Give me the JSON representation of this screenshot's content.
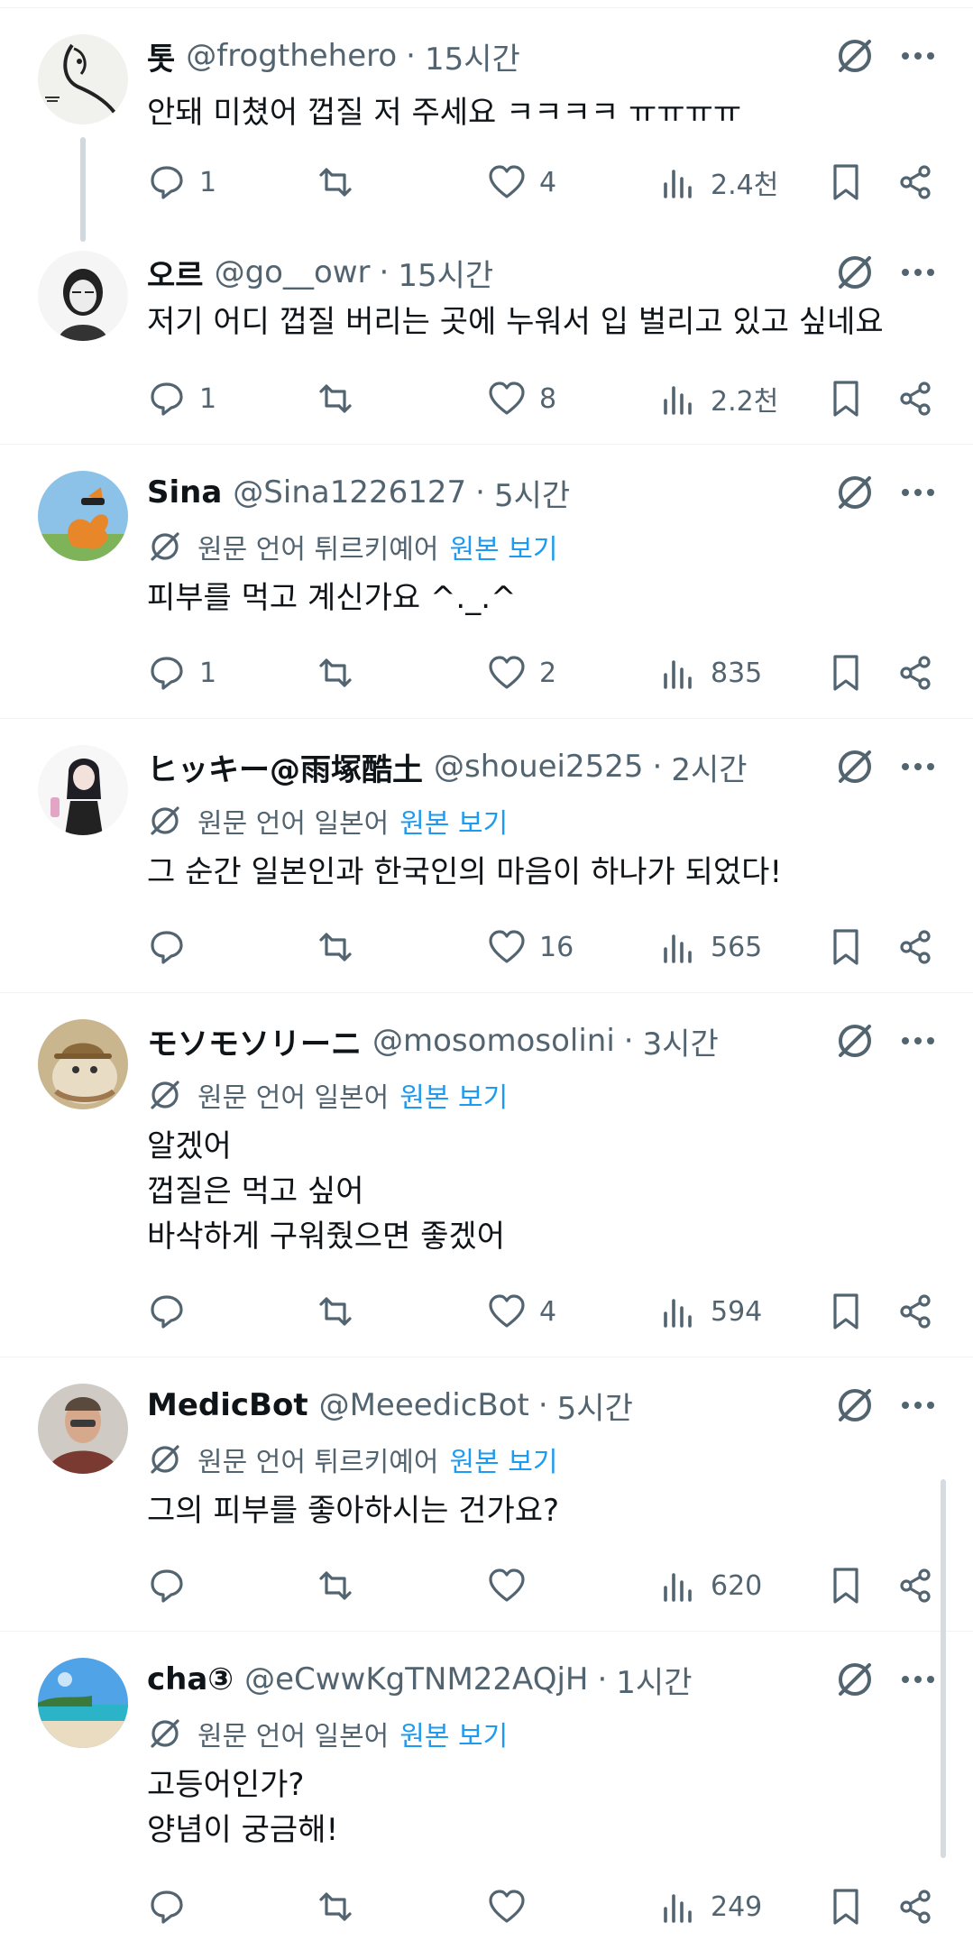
{
  "posts": [
    {
      "name": "톳",
      "handle": "@frogthehero",
      "separator": "·",
      "time": "15시간",
      "translate": null,
      "lines": [
        "안돼 미쳤어 껍질 저 주세요 ㅋㅋㅋㅋ ㅠㅠㅠㅠ"
      ],
      "reply_count": "1",
      "like_count": "4",
      "view_count": "2.4천"
    },
    {
      "name": "오르",
      "handle": "@go__owr",
      "separator": "·",
      "time": "15시간",
      "translate": null,
      "lines": [
        "저기 어디 껍질 버리는 곳에 누워서 입 벌리고 있고 싶네요"
      ],
      "reply_count": "1",
      "like_count": "8",
      "view_count": "2.2천"
    },
    {
      "name": "Sina",
      "handle": "@Sina1226127",
      "separator": "·",
      "time": "5시간",
      "translate": {
        "language": "원문 언어 튀르키예어",
        "link": "원본 보기"
      },
      "lines": [
        "피부를 먹고 계신가요 ^._.^"
      ],
      "reply_count": "1",
      "like_count": "2",
      "view_count": "835"
    },
    {
      "name": "ヒッキー@雨塚酷土",
      "handle": "@shouei2525",
      "separator": "·",
      "time": "2시간",
      "translate": {
        "language": "원문 언어 일본어",
        "link": "원본 보기"
      },
      "lines": [
        "그 순간 일본인과 한국인의 마음이 하나가 되었다!"
      ],
      "reply_count": "",
      "like_count": "16",
      "view_count": "565"
    },
    {
      "name": "モソモソリーニ",
      "handle": "@mosomosolini",
      "separator": "·",
      "time": "3시간",
      "translate": {
        "language": "원문 언어 일본어",
        "link": "원본 보기"
      },
      "lines": [
        "알겠어",
        "껍질은 먹고 싶어",
        "바삭하게 구워줬으면 좋겠어"
      ],
      "reply_count": "",
      "like_count": "4",
      "view_count": "594"
    },
    {
      "name": "MedicBot",
      "handle": "@MeeedicBot",
      "separator": "·",
      "time": "5시간",
      "translate": {
        "language": "원문 언어 튀르키예어",
        "link": "원본 보기"
      },
      "lines": [
        "그의 피부를 좋아하시는 건가요?"
      ],
      "reply_count": "",
      "like_count": "",
      "view_count": "620"
    },
    {
      "name": "cha③",
      "handle": "@eCwwKgTNM22AQjH",
      "separator": "·",
      "time": "1시간",
      "translate": {
        "language": "원문 언어 일본어",
        "link": "원본 보기"
      },
      "lines": [
        "고등어인가?",
        "양념이 궁금해!"
      ],
      "reply_count": "",
      "like_count": "",
      "view_count": "249"
    }
  ],
  "icons": {
    "grok": "grok-icon",
    "more": "more-icon",
    "translate": "translate-icon",
    "reply": "reply-icon",
    "repost": "repost-icon",
    "like": "like-icon",
    "views": "views-icon",
    "bookmark": "bookmark-icon",
    "share": "share-icon"
  },
  "colors": {
    "text_primary": "#0f1419",
    "text_secondary": "#536471",
    "link": "#1d9bf0",
    "divider": "#eff3f4",
    "thread_line": "#cfd9de"
  }
}
